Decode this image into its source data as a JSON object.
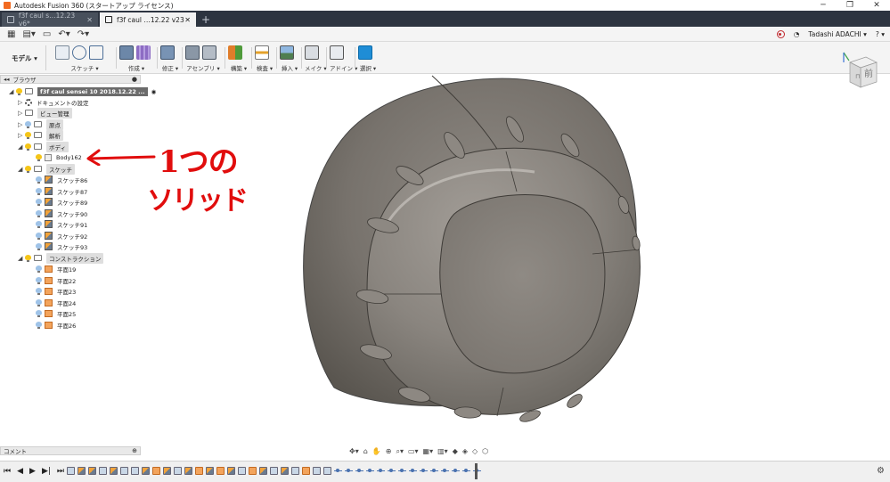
{
  "window": {
    "title": "Autodesk Fusion 360 (スタートアップ ライセンス)"
  },
  "tabs": [
    {
      "label": "f3f caul s…12.23  v6*",
      "active": false
    },
    {
      "label": "f3f caul …12.22 v23",
      "active": true
    }
  ],
  "toolbar": {
    "workspace": "モデル ▾",
    "user": "Tadashi ADACHI ▾",
    "help": "? ▾",
    "groups": [
      {
        "label": "スケッチ ▾"
      },
      {
        "label": "作成 ▾"
      },
      {
        "label": "修正 ▾"
      },
      {
        "label": "アセンブリ ▾"
      },
      {
        "label": "構築 ▾"
      },
      {
        "label": "検査 ▾"
      },
      {
        "label": "挿入 ▾"
      },
      {
        "label": "メイク ▾"
      },
      {
        "label": "アドイン ▾"
      },
      {
        "label": "選択 ▾"
      }
    ]
  },
  "browser": {
    "title": "ブラウザ",
    "root": "f3f caul sensei 10 2018.12.22 ...",
    "items": [
      {
        "label": "ドキュメントの設定"
      },
      {
        "label": "ビュー管理"
      },
      {
        "label": "原点"
      },
      {
        "label": "解析"
      },
      {
        "label": "ボディ"
      },
      {
        "label": "Body162"
      },
      {
        "label": "スケッチ"
      },
      {
        "label": "スケッチ86"
      },
      {
        "label": "スケッチ87"
      },
      {
        "label": "スケッチ89"
      },
      {
        "label": "スケッチ90"
      },
      {
        "label": "スケッチ91"
      },
      {
        "label": "スケッチ92"
      },
      {
        "label": "スケッチ93"
      },
      {
        "label": "コンストラクション"
      },
      {
        "label": "平面19"
      },
      {
        "label": "平面22"
      },
      {
        "label": "平面23"
      },
      {
        "label": "平面24"
      },
      {
        "label": "平面25"
      },
      {
        "label": "平面26"
      }
    ]
  },
  "comments": {
    "title": "コメント"
  },
  "annotation": {
    "line1": "1つの",
    "line2": "ソリッド"
  },
  "viewcube": {
    "face": "前"
  },
  "colors": {
    "annotation": "#e10d0d",
    "select_active": "#1f8dd6",
    "tabbar": "#2d3440"
  }
}
